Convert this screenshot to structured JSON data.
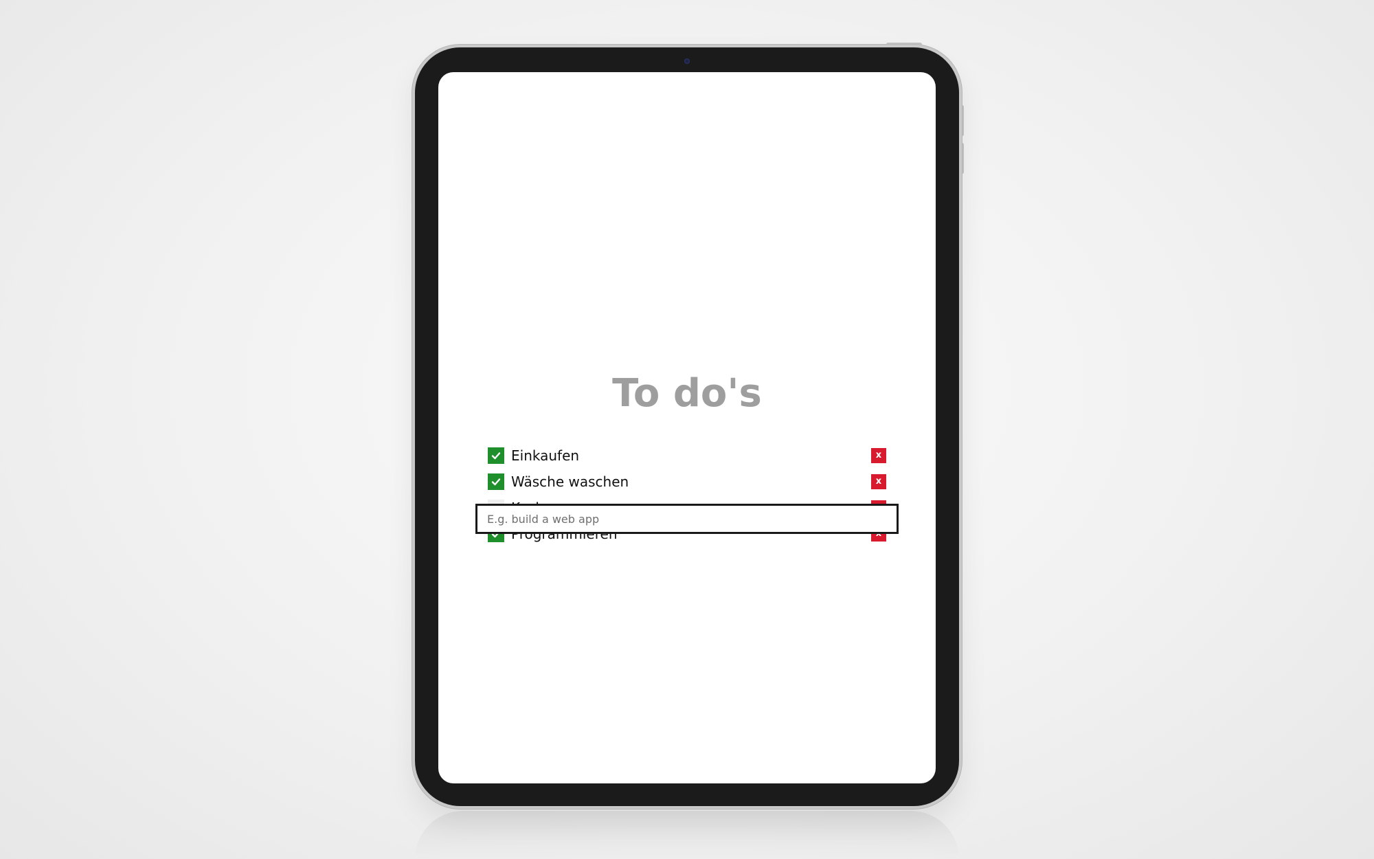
{
  "app": {
    "title": "To do's"
  },
  "todos": [
    {
      "label": "Einkaufen",
      "done": true,
      "delete_label": "x"
    },
    {
      "label": "Wäsche waschen",
      "done": true,
      "delete_label": "x"
    },
    {
      "label": "Kochen",
      "done": false,
      "delete_label": "x"
    },
    {
      "label": "Programmieren",
      "done": true,
      "delete_label": "x"
    }
  ],
  "new_todo": {
    "value": "",
    "placeholder": "E.g. build a web app"
  },
  "colors": {
    "checked": "#1f8f2b",
    "unchecked": "#efefef",
    "delete": "#d71a2d",
    "title": "#9e9e9e"
  },
  "icons": {
    "check": "check-icon",
    "delete": "close-icon"
  }
}
